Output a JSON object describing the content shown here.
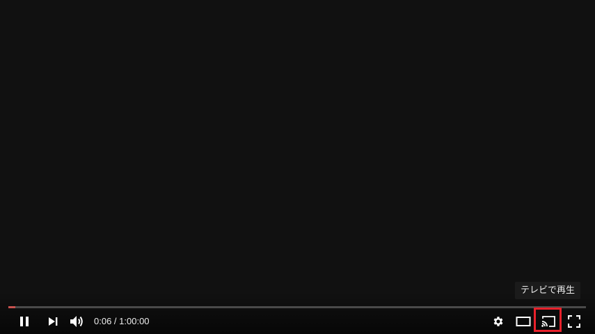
{
  "player": {
    "tooltip_text": "テレビで再生",
    "time": {
      "current": "0:06",
      "separator": " / ",
      "duration": "1:00:00"
    },
    "progress": {
      "played_fraction": 0.012
    },
    "colors": {
      "background": "#111111",
      "progress_played": "#c8524f",
      "highlight_box": "#e8212b",
      "icon": "#ffffff"
    },
    "icons": {
      "pause": "pause-icon",
      "next": "next-icon",
      "volume": "volume-icon",
      "settings": "gear-icon",
      "theater": "theater-mode-icon",
      "cast": "cast-icon",
      "fullscreen": "fullscreen-icon"
    }
  }
}
